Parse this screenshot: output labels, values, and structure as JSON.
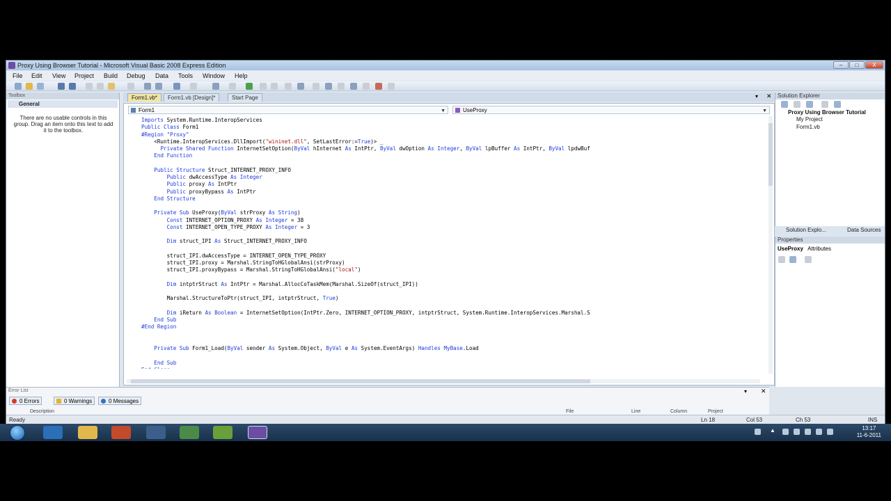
{
  "window": {
    "title": "Proxy Using Browser Tutorial - Microsoft Visual Basic 2008 Express Edition",
    "controls": [
      "–",
      "□",
      "X"
    ]
  },
  "menu": [
    "File",
    "Edit",
    "View",
    "Project",
    "Build",
    "Debug",
    "Data",
    "Tools",
    "Window",
    "Help"
  ],
  "toolbox": {
    "title": "Toolbox",
    "group": "General",
    "message": "There are no usable controls in this group. Drag an item onto this text to add it to the toolbox."
  },
  "editor": {
    "tabs": [
      "Form1.vb*",
      "Form1.vb [Design]*",
      "Start Page"
    ],
    "class_dropdown": "Form1",
    "method_dropdown": "UseProxy"
  },
  "code_lines": [
    "Imports System.Runtime.InteropServices",
    "Public Class Form1",
    "#Region \"Proxy\"",
    "    <Runtime.InteropServices.DllImport(\"wininet.dll\", SetLastError:=True)> _",
    "      Private Shared Function InternetSetOption(ByVal hInternet As IntPtr, ByVal dwOption As Integer, ByVal lpBuffer As IntPtr, ByVal lpdwBuf",
    "    End Function",
    "",
    "    Public Structure Struct_INTERNET_PROXY_INFO",
    "        Public dwAccessType As Integer",
    "        Public proxy As IntPtr",
    "        Public proxyBypass As IntPtr",
    "    End Structure",
    "",
    "    Private Sub UseProxy(ByVal strProxy As String)",
    "        Const INTERNET_OPTION_PROXY As Integer = 38",
    "        Const INTERNET_OPEN_TYPE_PROXY As Integer = 3",
    "",
    "        Dim struct_IPI As Struct_INTERNET_PROXY_INFO",
    "",
    "        struct_IPI.dwAccessType = INTERNET_OPEN_TYPE_PROXY",
    "        struct_IPI.proxy = Marshal.StringToHGlobalAnsi(strProxy)",
    "        struct_IPI.proxyBypass = Marshal.StringToHGlobalAnsi(\"local\")",
    "",
    "        Dim intptrStruct As IntPtr = Marshal.AllocCoTaskMem(Marshal.SizeOf(struct_IPI))",
    "",
    "        Marshal.StructureToPtr(struct_IPI, intptrStruct, True)",
    "",
    "        Dim iReturn As Boolean = InternetSetOption(IntPtr.Zero, INTERNET_OPTION_PROXY, intptrStruct, System.Runtime.InteropServices.Marshal.S",
    "    End Sub",
    "#End Region",
    "",
    "",
    "    Private Sub Form1_Load(ByVal sender As System.Object, ByVal e As System.EventArgs) Handles MyBase.Load",
    "",
    "    End Sub",
    "End Class"
  ],
  "solution_explorer": {
    "title": "Solution Explorer",
    "project": "Proxy Using Browser Tutorial",
    "items": [
      "My Project",
      "Form1.vb"
    ],
    "tabs": [
      "Solution Explo...",
      "Data Sources"
    ]
  },
  "properties": {
    "title": "Properties",
    "object": "UseProxy",
    "object_type": "Attributes"
  },
  "error_list": {
    "title": "Error List",
    "errors": "0 Errors",
    "warnings": "0 Warnings",
    "messages": "0 Messages",
    "columns": [
      "Description",
      "File",
      "Line",
      "Column",
      "Project"
    ]
  },
  "status": {
    "text": "Ready",
    "ln": "Ln 18",
    "col": "Col 53",
    "ch": "Ch 53",
    "mode": "INS"
  },
  "clock": {
    "time": "13:17",
    "date": "11-6-2011"
  },
  "colors": {
    "keyword": "#1e3bd8",
    "string": "#a31515",
    "tab_active": "#f1e5a6"
  }
}
